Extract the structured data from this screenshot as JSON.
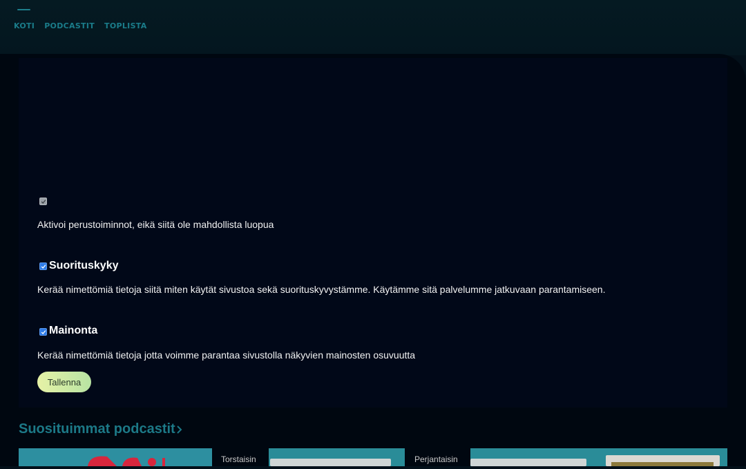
{
  "nav": {
    "items": [
      "KOTI",
      "PODCASTIT",
      "TOPLISTA"
    ]
  },
  "consent": {
    "essential_text": "Aktivoi perustoiminnot, eikä siitä ole mahdollista luopua",
    "performance_title": "Suorituskyky",
    "performance_text": "Kerää nimettömiä tietoja siitä miten käytät sivustoa sekä suorituskyvystämme. Käytämme sitä palvelumme jatkuvaan parantamiseen.",
    "advertising_title": "Mainonta",
    "advertising_text": "Kerää nimettömiä tietoja jotta voimme parantaa sivustolla näkyvien mainosten osuvuutta",
    "save_label": "Tallenna"
  },
  "section": {
    "title": "Suosituimmat podcastit",
    "cards": [
      {
        "label": ""
      },
      {
        "label": "Torstaisin"
      },
      {
        "label": "Perjantaisin"
      }
    ]
  },
  "colors": {
    "accent": "#1c7987",
    "button_start": "#e6f2a6",
    "button_end": "#b8e3a3",
    "checkbox": "#2f7ce8"
  }
}
